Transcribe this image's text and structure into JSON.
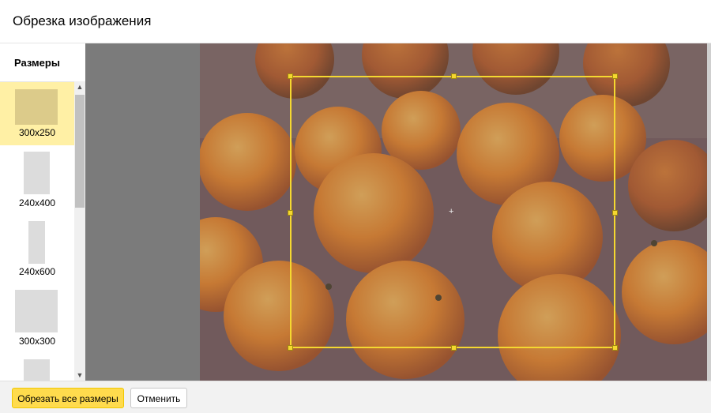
{
  "header": {
    "title": "Обрезка изображения"
  },
  "sidebar": {
    "title": "Размеры",
    "sizes": [
      {
        "label": "300x250",
        "selected": true
      },
      {
        "label": "240x400",
        "selected": false
      },
      {
        "label": "240x600",
        "selected": false
      },
      {
        "label": "300x300",
        "selected": false
      },
      {
        "label": "",
        "selected": false
      }
    ]
  },
  "scrollbar": {
    "up_icon": "chevron-up-icon",
    "down_icon": "chevron-down-icon"
  },
  "editor": {
    "image_subject": "oranges-photo",
    "crop_center_icon": "crosshair-icon",
    "crop_color": "#f5d830"
  },
  "footer": {
    "crop_all_label": "Обрезать все размеры",
    "cancel_label": "Отменить"
  },
  "colors": {
    "accent": "#ffdb4d",
    "selected_bg": "#fff0a5"
  }
}
